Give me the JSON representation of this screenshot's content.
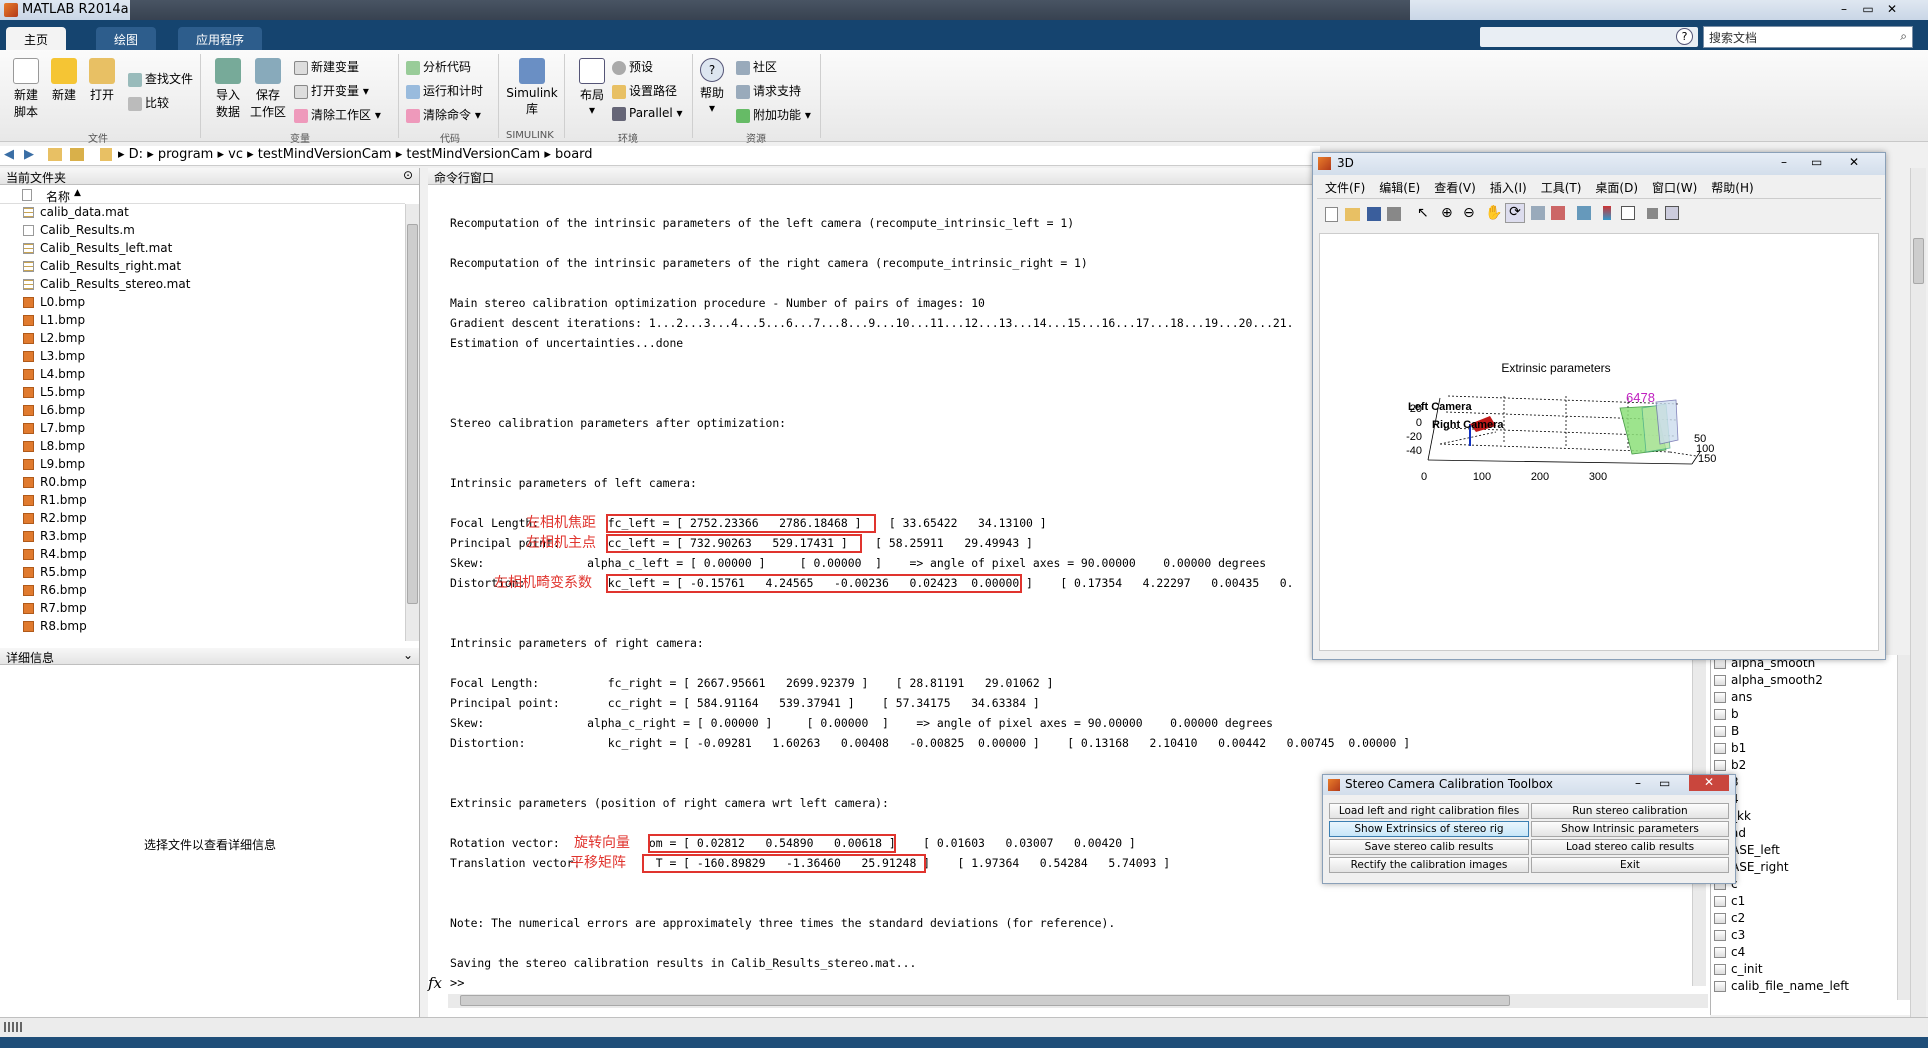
{
  "app": {
    "title": "MATLAB R2014a",
    "tabs": [
      "主页",
      "绘图",
      "应用程序"
    ],
    "search_placeholder": "搜索文档"
  },
  "ribbon": {
    "file": {
      "new_script": "新建\n脚本",
      "new": "新建",
      "open": "打开",
      "find_files": "查找文件",
      "compare": "比较",
      "group": "文件"
    },
    "variable": {
      "import": "导入\n数据",
      "save_ws": "保存\n工作区",
      "new_var": "新建变量",
      "open_var": "打开变量",
      "clear_ws": "清除工作区",
      "group": "变量"
    },
    "code": {
      "analyze": "分析代码",
      "run_time": "运行和计时",
      "clear_cmds": "清除命令",
      "group": "代码"
    },
    "simulink": {
      "label": "Simulink\n库",
      "group": "SIMULINK"
    },
    "env": {
      "layout": "布局",
      "prefs": "预设",
      "set_path": "设置路径",
      "parallel": "Parallel",
      "group": "环境"
    },
    "resources": {
      "help": "帮助",
      "community": "社区",
      "request_support": "请求支持",
      "addons": "附加功能",
      "group": "资源"
    }
  },
  "address": {
    "path": [
      "D:",
      "program",
      "vc",
      "testMindVersionCam",
      "testMindVersionCam",
      "board"
    ]
  },
  "left_panel": {
    "title": "当前文件夹",
    "col_name": "名称",
    "files": [
      "calib_data.mat",
      "Calib_Results.m",
      "Calib_Results_left.mat",
      "Calib_Results_right.mat",
      "Calib_Results_stereo.mat",
      "L0.bmp",
      "L1.bmp",
      "L2.bmp",
      "L3.bmp",
      "L4.bmp",
      "L5.bmp",
      "L6.bmp",
      "L7.bmp",
      "L8.bmp",
      "L9.bmp",
      "R0.bmp",
      "R1.bmp",
      "R2.bmp",
      "R3.bmp",
      "R4.bmp",
      "R5.bmp",
      "R6.bmp",
      "R7.bmp",
      "R8.bmp"
    ],
    "details_title": "详细信息",
    "details_hint": "选择文件以查看详细信息"
  },
  "command_window": {
    "title": "命令行窗口",
    "lines": [
      "Recomputation of the intrinsic parameters of the left camera (recompute_intrinsic_left = 1)",
      "Recomputation of the intrinsic parameters of the right camera (recompute_intrinsic_right = 1)",
      "Main stereo calibration optimization procedure - Number of pairs of images: 10",
      "Gradient descent iterations: 1...2...3...4...5...6...7...8...9...10...11...12...13...14...15...16...17...18...19...20...21.",
      "Estimation of uncertainties...done",
      "Stereo calibration parameters after optimization:",
      "Intrinsic parameters of left camera:",
      "Focal Length:          fc_left = [ 2752.23366   2786.18468 ]    [ 33.65422   34.13100 ]",
      "Principal point:       cc_left = [ 732.90263   529.17431 ]    [ 58.25911   29.49943 ]",
      "Skew:               alpha_c_left = [ 0.00000 ]     [ 0.00000  ]    => angle of pixel axes = 90.00000    0.00000 degrees",
      "Distortion:            kc_left = [ -0.15761   4.24565   -0.00236   0.02423  0.00000 ]    [ 0.17354   4.22297   0.00435   0.",
      "Intrinsic parameters of right camera:",
      "Focal Length:          fc_right = [ 2667.95661   2699.92379 ]    [ 28.81191   29.01062 ]",
      "Principal point:       cc_right = [ 584.91164   539.37941 ]    [ 57.34175   34.63384 ]",
      "Skew:               alpha_c_right = [ 0.00000 ]     [ 0.00000  ]    => angle of pixel axes = 90.00000    0.00000 degrees",
      "Distortion:            kc_right = [ -0.09281   1.60263   0.00408   -0.00825  0.00000 ]    [ 0.13168   2.10410   0.00442   0.00745  0.00000 ]",
      "Extrinsic parameters (position of right camera wrt left camera):",
      "Rotation vector:             om = [ 0.02812   0.54890   0.00618 ]    [ 0.01603   0.03007   0.00420 ]",
      "Translation vector:           T = [ -160.89829   -1.36460   25.91248 ]    [ 1.97364   0.54284   5.74093 ]",
      "Note: The numerical errors are approximately three times the standard deviations (for reference).",
      "Saving the stereo calibration results in Calib_Results_stereo.mat..."
    ],
    "prompt": ">>",
    "fx": "fx",
    "annotations": {
      "focal": "左相机焦距",
      "principal": "左相机主点",
      "distortion": "左相机畸变系数",
      "rotation": "旋转向量",
      "translation": "平移矩阵"
    }
  },
  "figure": {
    "title": "3D",
    "menu": [
      "文件(F)",
      "编辑(E)",
      "查看(V)",
      "插入(I)",
      "工具(T)",
      "桌面(D)",
      "窗口(W)",
      "帮助(H)"
    ],
    "plot_title": "Extrinsic parameters",
    "left_camera": "Left Camera",
    "right_camera": "Right Camera",
    "y_ticks": [
      "20",
      "0",
      "-20",
      "-40"
    ],
    "x_ticks": [
      "0",
      "100",
      "200",
      "300"
    ],
    "z_ticks": [
      "50",
      "100",
      "150"
    ],
    "board_labels": "6478"
  },
  "toolbox": {
    "title": "Stereo Camera Calibration Toolbox",
    "buttons": [
      "Load left and right calibration files",
      "Run stereo calibration",
      "Show Extrinsics of stereo rig",
      "Show Intrinsic parameters",
      "Save stereo calib results",
      "Load stereo calib results",
      "Rectify the calibration images",
      "Exit"
    ]
  },
  "workspace": {
    "vars": [
      "alpha_smooth",
      "alpha_smooth2",
      "ans",
      "b",
      "B",
      "b1",
      "b2",
      "3",
      "4",
      "_kk",
      "ad",
      "ASE_left",
      "ASE_right",
      "c",
      "c1",
      "c2",
      "c3",
      "c4",
      "c_init",
      "calib_file_name_left"
    ]
  },
  "colors": {
    "tab_bg": "#15446f",
    "annotation_red": "#e0342e"
  }
}
